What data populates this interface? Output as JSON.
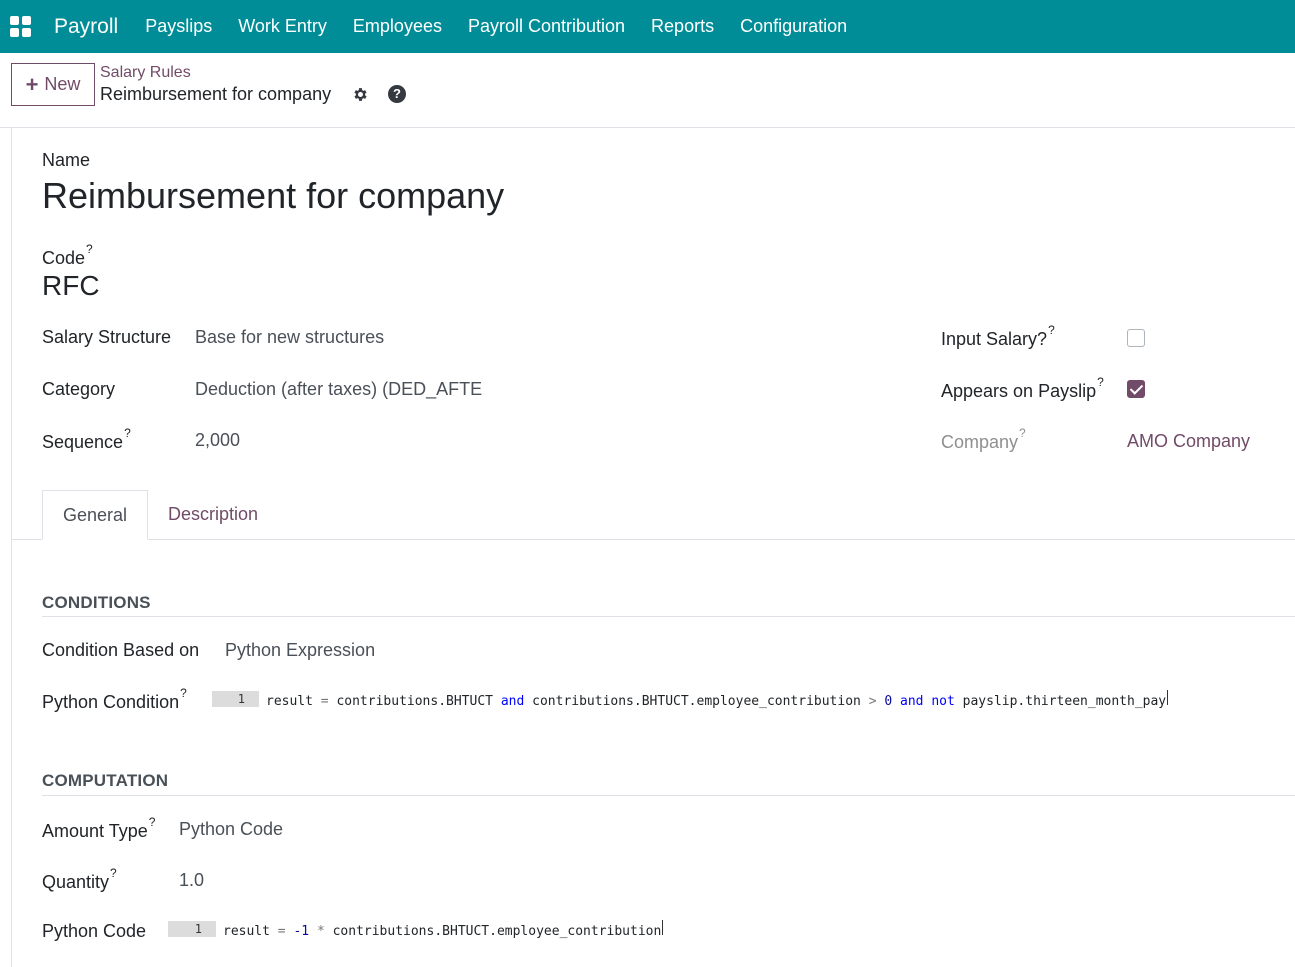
{
  "app": {
    "brand": "Payroll",
    "nav": [
      "Payslips",
      "Work Entry",
      "Employees",
      "Payroll Contribution",
      "Reports",
      "Configuration"
    ]
  },
  "control": {
    "new_label": "New",
    "breadcrumb": "Salary Rules",
    "title": "Reimbursement for company"
  },
  "form": {
    "name_label": "Name",
    "name_value": "Reimbursement for company",
    "code_label": "Code",
    "code_value": "RFC",
    "salary_structure_label": "Salary Structure",
    "salary_structure_value": "Base for new structures",
    "category_label": "Category",
    "category_value": "Deduction (after taxes) (DED_AFTE",
    "sequence_label": "Sequence",
    "sequence_value": "2,000",
    "input_salary_label": "Input Salary?",
    "input_salary_checked": false,
    "appears_label": "Appears on Payslip",
    "appears_checked": true,
    "company_label": "Company",
    "company_value": "AMO Company",
    "help_mark": "?"
  },
  "tabs": [
    "General",
    "Description"
  ],
  "conditions": {
    "title": "CONDITIONS",
    "based_on_label": "Condition Based on",
    "based_on_value": "Python Expression",
    "python_condition_label": "Python Condition",
    "line_no": "1",
    "code": {
      "t1": "result",
      "op1": "=",
      "t2": "contributions.BHTUCT",
      "kw1": "and",
      "t3": "contributions.BHTUCT.employee_contribution",
      "op2": ">",
      "n1": "0",
      "kw2": "and",
      "kw3": "not",
      "t4": "payslip.thirteen_month_pay"
    }
  },
  "computation": {
    "title": "COMPUTATION",
    "amount_type_label": "Amount Type",
    "amount_type_value": "Python Code",
    "quantity_label": "Quantity",
    "quantity_value": "1.0",
    "python_code_label": "Python Code",
    "line_no": "1",
    "code": {
      "t1": "result",
      "op1": "=",
      "n1": "-1",
      "op2": "*",
      "t2": "contributions.BHTUCT.employee_contribution"
    }
  },
  "colors": {
    "topbar": "#018d97",
    "accent": "#714b67"
  }
}
